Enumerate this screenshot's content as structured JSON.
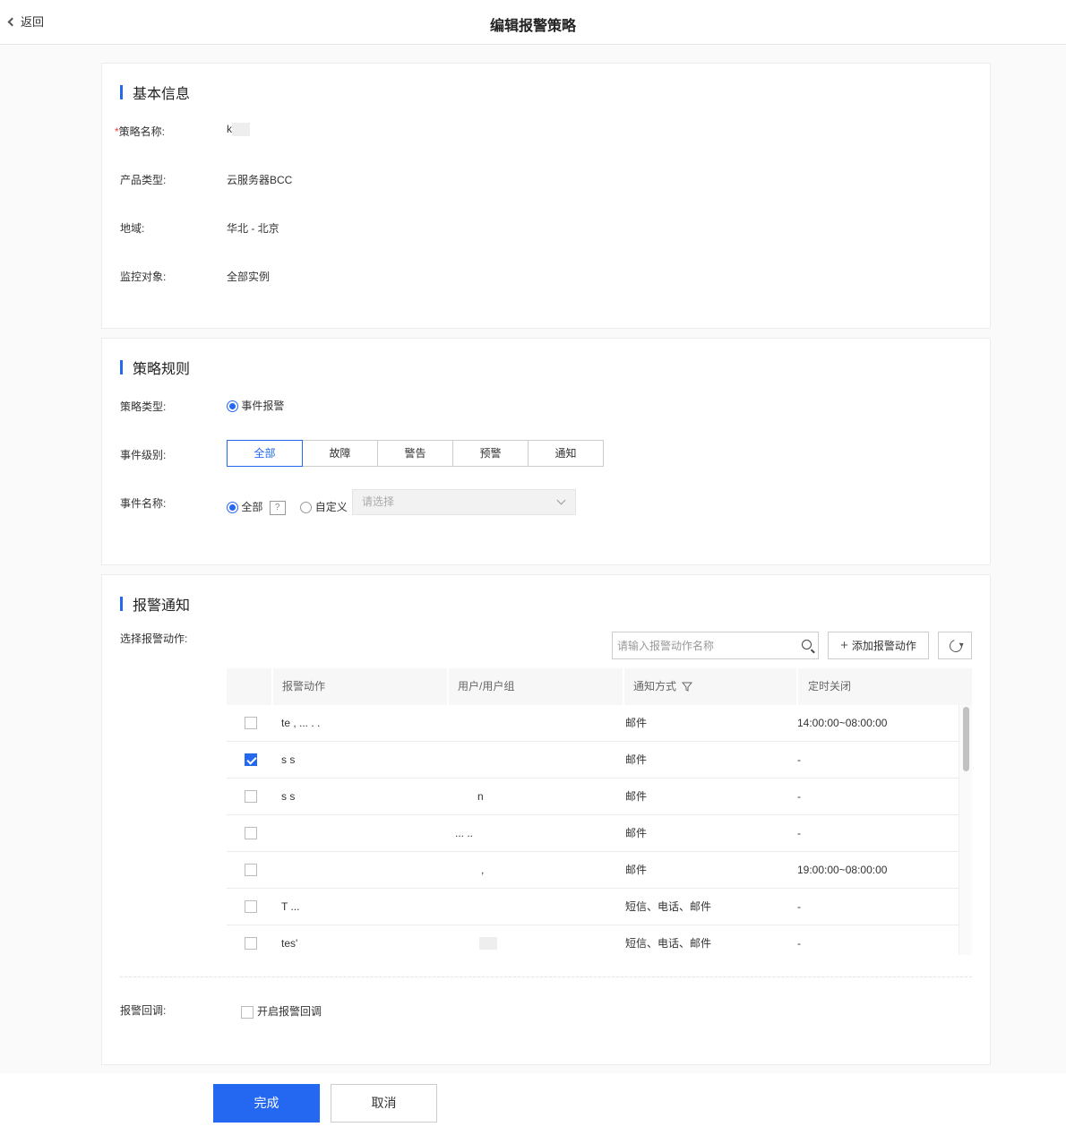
{
  "header": {
    "back_label": "返回",
    "title": "编辑报警策略"
  },
  "basic": {
    "section_title": "基本信息",
    "required_mark": "*",
    "name_label": "策略名称:",
    "name_value": "k",
    "product_label": "产品类型:",
    "product_value": "云服务器BCC",
    "region_label": "地域:",
    "region_value": "华北 - 北京",
    "target_label": "监控对象:",
    "target_value": "全部实例"
  },
  "rules": {
    "section_title": "策略规则",
    "type_label": "策略类型:",
    "type_option": "事件报警",
    "level_label": "事件级别:",
    "levels": [
      "全部",
      "故障",
      "警告",
      "预警",
      "通知"
    ],
    "event_name_label": "事件名称:",
    "event_all": "全部",
    "help_mark": "?",
    "event_custom": "自定义",
    "select_placeholder": "请选择"
  },
  "notify": {
    "section_title": "报警通知",
    "action_label": "选择报警动作:",
    "search_placeholder": "请输入报警动作名称",
    "add_button": "添加报警动作",
    "columns": [
      "报警动作",
      "用户/用户组",
      "通知方式",
      "定时关闭"
    ],
    "rows": [
      {
        "action": "te  ,  ...  . .",
        "users": "",
        "method": "邮件",
        "close": "14:00:00~08:00:00",
        "checked": false
      },
      {
        "action": "s    s",
        "users": "",
        "method": "邮件",
        "close": "-",
        "checked": true
      },
      {
        "action": "s  s",
        "users": "n",
        "method": "邮件",
        "close": "-",
        "checked": false
      },
      {
        "action": "",
        "users": "... ..",
        "method": "邮件",
        "close": "-",
        "checked": false
      },
      {
        "action": "",
        "users": ",",
        "method": "邮件",
        "close": "19:00:00~08:00:00",
        "checked": false
      },
      {
        "action": "T              ...",
        "users": "",
        "method": "短信、电话、邮件",
        "close": "-",
        "checked": false
      },
      {
        "action": "tes'",
        "users": "",
        "method": "短信、电话、邮件",
        "close": "-",
        "checked": false
      }
    ],
    "callback_label": "报警回调:",
    "callback_option": "开启报警回调"
  },
  "footer": {
    "confirm": "完成",
    "cancel": "取消"
  },
  "colors": {
    "accent": "#2468f2",
    "required": "#f33e3e"
  }
}
